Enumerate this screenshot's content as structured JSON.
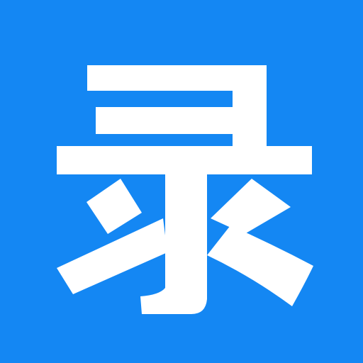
{
  "app_icon": {
    "glyph": "录",
    "glyph_color": "#ffffff",
    "background_color": "#1487f3"
  }
}
